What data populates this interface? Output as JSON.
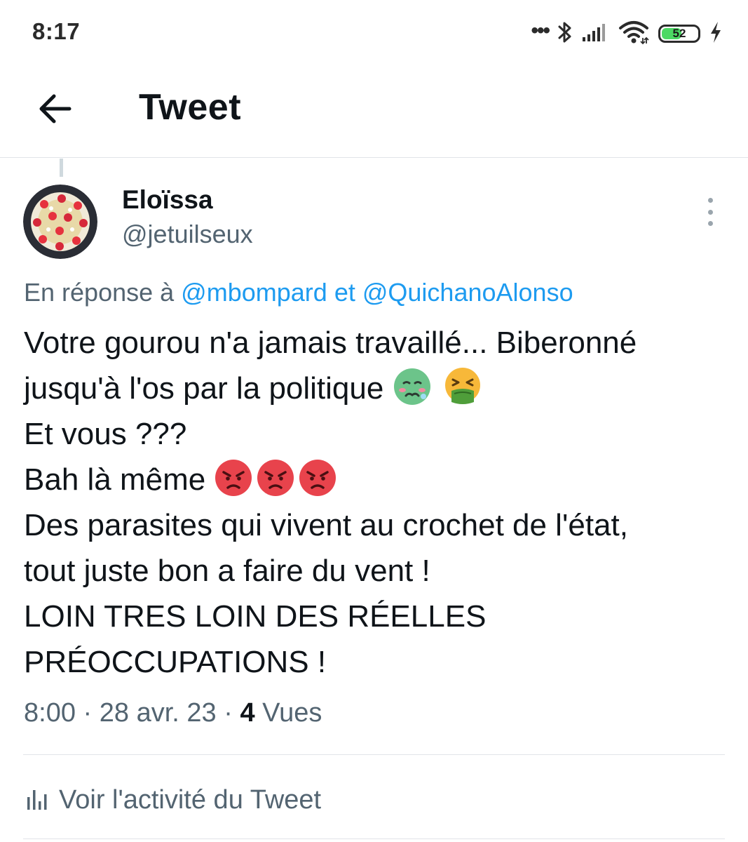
{
  "status_bar": {
    "time": "8:17",
    "more_indicator": "•••",
    "battery_level": "52",
    "icons": [
      "bluetooth-icon",
      "signal-icon",
      "wifi-icon",
      "battery-icon",
      "charging-icon"
    ]
  },
  "header": {
    "title": "Tweet",
    "back_icon": "arrow-left-icon"
  },
  "tweet": {
    "author": {
      "name": "Eloïssa",
      "handle": "@jetuilseux"
    },
    "reply_context": {
      "prefix": "En réponse à",
      "mention_1": "@mbompard",
      "conjunction": "et",
      "mention_2": "@QuichanoAlonso"
    },
    "lines": [
      "Votre gourou n'a jamais travaillé... Biberonné",
      "jusqu'à l'os par la politique",
      "Et vous ???",
      "Bah là même",
      "Des parasites qui vivent au crochet de l'état,",
      "tout juste bon a faire du vent !",
      "LOIN TRES LOIN DES RÉELLES",
      "PRÉOCCUPATIONS !"
    ],
    "emojis": {
      "line_2": [
        "nauseated-face-emoji",
        "vomiting-face-emoji"
      ],
      "line_4": [
        "angry-face-emoji",
        "angry-face-emoji",
        "angry-face-emoji"
      ]
    },
    "time": "8:00",
    "separator": "·",
    "date": "28 avr. 23",
    "views_count": "4",
    "views_label": "Vues"
  },
  "activity": {
    "label": "Voir l'activité du Tweet",
    "icon": "analytics-icon"
  },
  "colors": {
    "text_primary": "#0f1419",
    "text_secondary": "#536471",
    "link": "#1d9bf0",
    "divider": "#e1e4e8",
    "battery_fill": "#4cd964"
  }
}
